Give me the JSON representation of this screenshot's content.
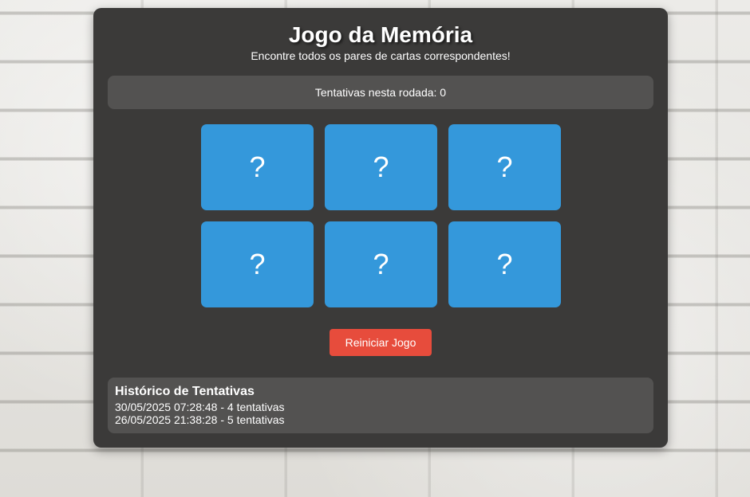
{
  "header": {
    "title": "Jogo da Memória",
    "subtitle": "Encontre todos os pares de cartas correspondentes!"
  },
  "status": {
    "attempts_text": "Tentativas nesta rodada: 0"
  },
  "cards": [
    {
      "face": "?"
    },
    {
      "face": "?"
    },
    {
      "face": "?"
    },
    {
      "face": "?"
    },
    {
      "face": "?"
    },
    {
      "face": "?"
    }
  ],
  "controls": {
    "restart_label": "Reiniciar Jogo"
  },
  "history": {
    "title": "Histórico de Tentativas",
    "entries": [
      "30/05/2025 07:28:48 - 4 tentativas",
      "26/05/2025 21:38:28 - 5 tentativas"
    ]
  },
  "colors": {
    "panel": "#3b3a39",
    "card": "#3498db",
    "button": "#e74c3c"
  }
}
